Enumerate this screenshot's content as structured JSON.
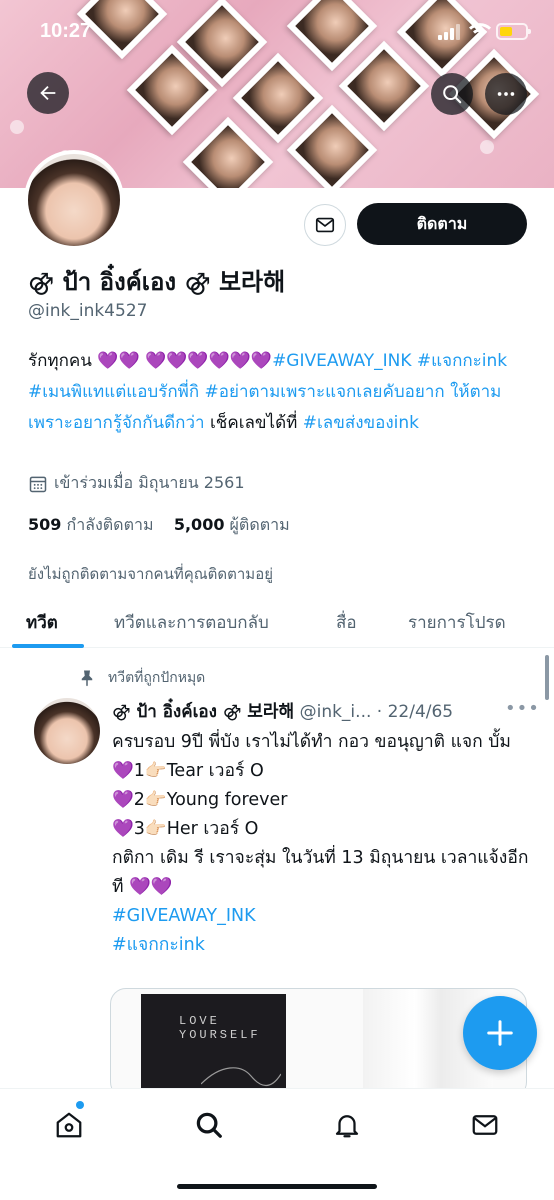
{
  "status_bar": {
    "time": "10:27"
  },
  "profile": {
    "display_name": "⚣ ป้า อิ๋งค์เอง ⚣ 보라해",
    "handle": "@ink_ink4527",
    "follow_label": "ติดตาม",
    "bio_text": "รักทุกคน 💜💜 💜💜💜💜💜💜",
    "bio_tags_1": "#GIVEAWAY_INK",
    "bio_tags_2": "#แจกกะink #เมนพิแทแต่แอบรักพี่กิ #อย่าตามเพราะแจกเลยคับอยาก ให้ตามเพราะอยากรู้จักกันดีกว่า",
    "bio_tail": "เช็คเลขได้ที่",
    "bio_tag_3": "#เลขส่งของink",
    "joined": "เข้าร่วมเมื่อ มิถุนายน 2561",
    "following_count": "509",
    "following_label": "กำลังติดตาม",
    "followers_count": "5,000",
    "followers_label": "ผู้ติดตาม",
    "not_followed_text": "ยังไม่ถูกติดตามจากคนที่คุณติดตามอยู่"
  },
  "tabs": [
    "ทวีต",
    "ทวีตและการตอบกลับ",
    "สื่อ",
    "รายการโปรด"
  ],
  "tweet": {
    "pinned_label": "ทวีตที่ถูกปักหมุด",
    "author_name": "⚣ ป้า อิ๋งค์เอง ⚣ 보라해",
    "author_handle": "@ink_i...",
    "date": "· 22/4/65",
    "line1": "ครบรอบ 9ปี พี่บัง เราไม่ได้ทำ กอว ขอนุญาติ แจก บั้ม",
    "line2": "💜1👉🏻Tear เวอร์ O",
    "line3": "💜2👉🏻Young forever",
    "line4": "💜3👉🏻Her เวอร์ O",
    "line5": "กติกา เดิม รี เราจะสุ่ม ในวันที่ 13 มิถุนายน เวลาแจ้งอีกที 💜💜",
    "tag1": "#GIVEAWAY_INK",
    "tag2": "#แจกกะink",
    "media_text": "LOVE YOURSELF"
  },
  "icons": [
    "back-icon",
    "search-icon",
    "more-icon",
    "mail-icon",
    "calendar-icon",
    "pin-icon",
    "compose-icon",
    "home-icon",
    "search-nav-icon",
    "notifications-icon",
    "messages-icon"
  ],
  "colors": {
    "accent": "#1d9bf0",
    "text": "#0f1419",
    "muted": "#536471",
    "button": "#0f1419"
  }
}
